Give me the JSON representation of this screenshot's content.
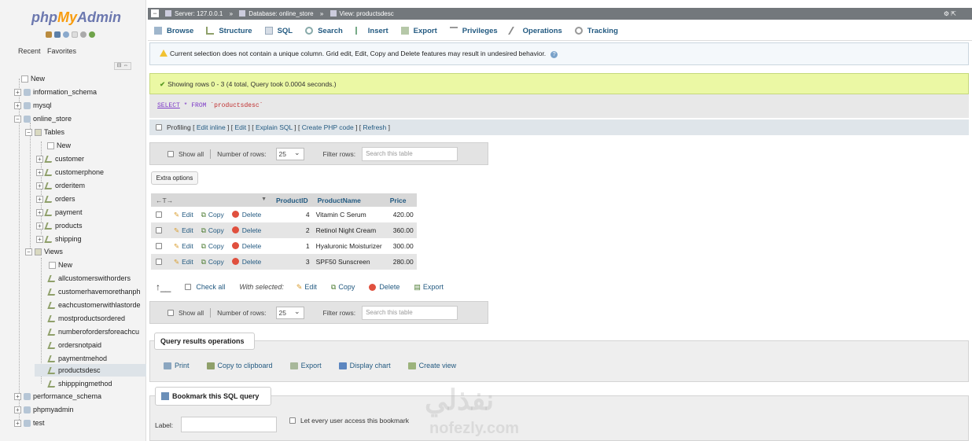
{
  "logo": {
    "php": "php",
    "my": "My",
    "admin": "Admin"
  },
  "left_tabs": {
    "recent": "Recent",
    "favorites": "Favorites"
  },
  "tree": {
    "new": "New",
    "information_schema": "information_schema",
    "mysql": "mysql",
    "online_store": "online_store",
    "tables": "Tables",
    "tables_new": "New",
    "table_items": [
      "customer",
      "customerphone",
      "orderitem",
      "orders",
      "payment",
      "products",
      "shipping"
    ],
    "views": "Views",
    "views_new": "New",
    "view_items": [
      "allcustomerswithorders",
      "customerhavemorethanph",
      "eachcustomerwithlastorde",
      "mostproductsordered",
      "numberofordersforeachcu",
      "ordersnotpaid",
      "paymentmehod",
      "productsdesc",
      "shipppingmethod"
    ],
    "performance_schema": "performance_schema",
    "phpmyadmin": "phpmyadmin",
    "test": "test"
  },
  "breadcrumb": {
    "server": "Server: 127.0.0.1",
    "database": "Database: online_store",
    "view": "View: productsdesc"
  },
  "menu": [
    "Browse",
    "Structure",
    "SQL",
    "Search",
    "Insert",
    "Export",
    "Privileges",
    "Operations",
    "Tracking"
  ],
  "notice": "Current selection does not contain a unique column. Grid edit, Edit, Copy and Delete features may result in undesired behavior.",
  "success": "Showing rows 0 - 3 (4 total, Query took 0.0004 seconds.)",
  "sql": {
    "select": "SELECT",
    "star": "*",
    "from": "FROM",
    "table": "`productsdesc`"
  },
  "profiling": {
    "label": "Profiling",
    "links": [
      "Edit inline",
      "Edit",
      "Explain SQL",
      "Create PHP code",
      "Refresh"
    ]
  },
  "nav": {
    "show_all": "Show all",
    "num_rows": "Number of rows:",
    "rows_value": "25",
    "filter": "Filter rows:",
    "filter_placeholder": "Search this table"
  },
  "extra_options": "Extra options",
  "table": {
    "arrows": "←T→",
    "sort_icon": "▼",
    "columns": [
      "ProductID",
      "ProductName",
      "Price"
    ],
    "action_labels": {
      "edit": "Edit",
      "copy": "Copy",
      "delete": "Delete"
    },
    "rows": [
      {
        "id": "4",
        "name": "Vitamin C Serum",
        "price": "420.00"
      },
      {
        "id": "2",
        "name": "Retinol Night Cream",
        "price": "360.00"
      },
      {
        "id": "1",
        "name": "Hyaluronic Moisturizer",
        "price": "300.00"
      },
      {
        "id": "3",
        "name": "SPF50 Sunscreen",
        "price": "280.00"
      }
    ]
  },
  "bulk": {
    "check_all": "Check all",
    "with_selected": "With selected:",
    "edit": "Edit",
    "copy": "Copy",
    "delete": "Delete",
    "export": "Export"
  },
  "qro": {
    "title": "Query results operations",
    "links": [
      "Print",
      "Copy to clipboard",
      "Export",
      "Display chart",
      "Create view"
    ]
  },
  "bookmark": {
    "title": "Bookmark this SQL query",
    "label": "Label:",
    "every_user": "Let every user access this bookmark"
  },
  "watermark": {
    "arabic": "نفذلي",
    "latin": "nofezly.com"
  }
}
